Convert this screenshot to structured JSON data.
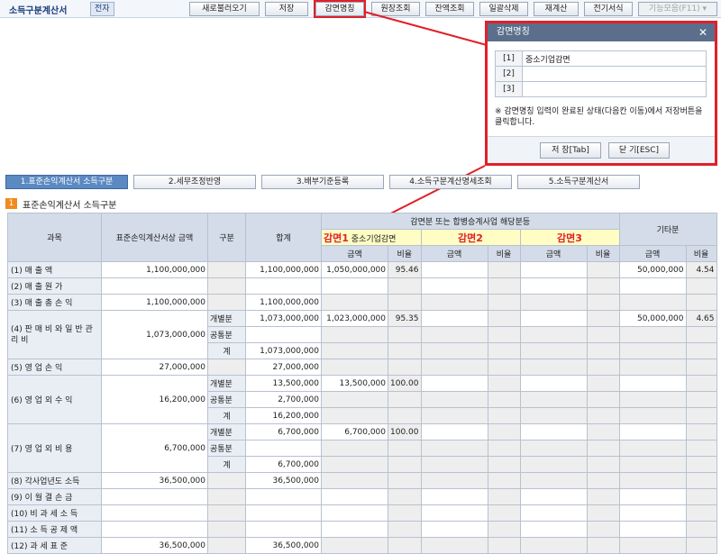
{
  "app": {
    "title": "소득구분계산서",
    "tag": "전자"
  },
  "toolbar": {
    "new_load": "새로불러오기",
    "save": "저장",
    "exempt_name": "감면명칭",
    "ledger": "원장조회",
    "balance": "잔액조회",
    "delete_all": "일괄삭제",
    "recalc": "재계산",
    "prev_form": "전기서식",
    "function_menu": "기능모음(F11) ▾"
  },
  "dialog": {
    "title": "감면명칭",
    "close": "✕",
    "rows": [
      {
        "idx": "[1]",
        "value": "중소기업감면"
      },
      {
        "idx": "[2]",
        "value": ""
      },
      {
        "idx": "[3]",
        "value": ""
      }
    ],
    "note": "※ 감면명칭 입력이 완료된 상태(다음칸 이동)에서 저장버튼을 클릭합니다.",
    "save_btn": "저 장[Tab]",
    "close_btn": "닫 기[ESC]"
  },
  "tabs": [
    "1.표준손익계산서 소득구분",
    "2.세무조정반영",
    "3.배부기준등록",
    "4.소득구분계산명세조회",
    "5.소득구분계산서"
  ],
  "section": {
    "num": "1",
    "title": "표준손익계산서 소득구분"
  },
  "table": {
    "h_subject": "과목",
    "h_std_amount": "표준손익계산서상 금액",
    "h_type": "구분",
    "h_total": "합계",
    "h_exempt_group": "감면분 또는 합병승계사업 해당분등",
    "h_other": "기타분",
    "exempt_name1": "중소기업감면",
    "label1": "감면1",
    "label2": "감면2",
    "label3": "감면3",
    "h_amount": "금액",
    "h_ratio": "비율",
    "type_individual": "개별분",
    "type_common": "공통분",
    "type_sum": "계",
    "rows": {
      "r1": {
        "label": "(1) 매 출 액",
        "std": "1,100,000,000",
        "total": "1,100,000,000",
        "e1amt": "1,050,000,000",
        "e1ratio": "95.46",
        "oamt": "50,000,000",
        "oratio": "4.54"
      },
      "r2": {
        "label": "(2) 매 출 원 가"
      },
      "r3": {
        "label": "(3) 매 출 총 손 익",
        "std": "1,100,000,000",
        "total": "1,100,000,000"
      },
      "r4": {
        "label": "(4) 판 매 비 와 일 반 관 리 비",
        "std": "1,073,000,000",
        "ind_total": "1,073,000,000",
        "ind_e1amt": "1,023,000,000",
        "ind_e1ratio": "95.35",
        "ind_oamt": "50,000,000",
        "ind_oratio": "4.65",
        "sum_total": "1,073,000,000"
      },
      "r5": {
        "label": "(5) 영 업 손 익",
        "std": "27,000,000",
        "total": "27,000,000"
      },
      "r6": {
        "label": "(6) 영 업 외 수 익",
        "std": "16,200,000",
        "ind_total": "13,500,000",
        "ind_e1amt": "13,500,000",
        "ind_e1ratio": "100.00",
        "com_total": "2,700,000",
        "sum_total": "16,200,000"
      },
      "r7": {
        "label": "(7) 영 업 외 비 용",
        "std": "6,700,000",
        "ind_total": "6,700,000",
        "ind_e1amt": "6,700,000",
        "ind_e1ratio": "100.00",
        "sum_total": "6,700,000"
      },
      "r8": {
        "label": "(8) 각사업년도 소득",
        "std": "36,500,000",
        "total": "36,500,000"
      },
      "r9": {
        "label": "(9) 이 월 결 손 금"
      },
      "r10": {
        "label": "(10) 비 과 세 소 득"
      },
      "r11": {
        "label": "(11) 소 득 공 제 액"
      },
      "r12": {
        "label": "(12) 과 세 표 준",
        "std": "36,500,000",
        "total": "36,500,000"
      }
    }
  },
  "colors": {
    "highlight": "#e0202a",
    "active_tab": "#5b89c2",
    "yellow": "#fffcc4",
    "badge": "#f08b1d"
  }
}
